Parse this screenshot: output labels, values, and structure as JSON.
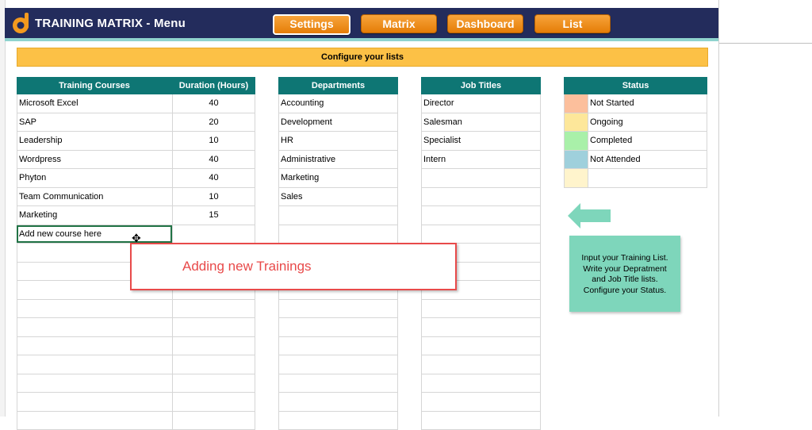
{
  "header": {
    "title": "TRAINING MATRIX - Menu",
    "nav": [
      {
        "label": "Settings",
        "active": true
      },
      {
        "label": "Matrix",
        "active": false
      },
      {
        "label": "Dashboard",
        "active": false
      },
      {
        "label": "List",
        "active": false
      }
    ],
    "colors": {
      "bar": "#232c5c",
      "button": "#f08b14",
      "accent": "#8fd3ce"
    }
  },
  "banner": {
    "label": "Configure your lists"
  },
  "courses": {
    "headers": [
      "Training Courses",
      "Duration (Hours)"
    ],
    "rows": [
      {
        "name": "Microsoft Excel",
        "hours": "40"
      },
      {
        "name": "SAP",
        "hours": "20"
      },
      {
        "name": "Leadership",
        "hours": "10"
      },
      {
        "name": "Wordpress",
        "hours": "40"
      },
      {
        "name": "Phyton",
        "hours": "40"
      },
      {
        "name": "Team Communication",
        "hours": "10"
      },
      {
        "name": "Marketing",
        "hours": "15"
      },
      {
        "name": "Add new course here",
        "hours": ""
      }
    ]
  },
  "departments": {
    "header": "Departments",
    "rows": [
      "Accounting",
      "Development",
      "HR",
      "Administrative",
      "Marketing",
      "Sales"
    ]
  },
  "job_titles": {
    "header": "Job Titles",
    "rows": [
      "Director",
      "Salesman",
      "Specialist",
      "Intern"
    ]
  },
  "status": {
    "header": "Status",
    "rows": [
      {
        "label": "Not Started",
        "color": "#fcbf9c"
      },
      {
        "label": "Ongoing",
        "color": "#fde79a"
      },
      {
        "label": "Completed",
        "color": "#a9f0a9"
      },
      {
        "label": "Not Attended",
        "color": "#9fd0dc"
      },
      {
        "label": "",
        "color": "#fff4cc"
      }
    ]
  },
  "annotation": {
    "text": "Adding new Trainings"
  },
  "note": {
    "lines": [
      "Input your Training List.",
      "Write your Depratment",
      "and Job Title lists.",
      "Configure your Status."
    ]
  }
}
